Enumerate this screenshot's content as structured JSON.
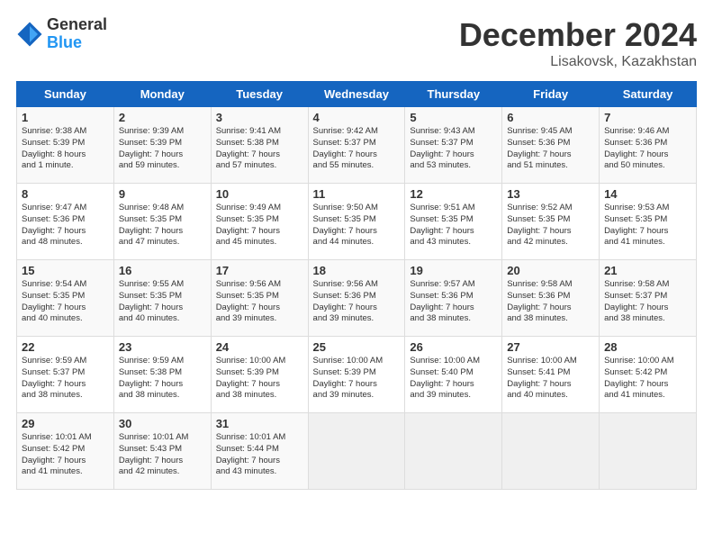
{
  "logo": {
    "general": "General",
    "blue": "Blue"
  },
  "header": {
    "month": "December 2024",
    "location": "Lisakovsk, Kazakhstan"
  },
  "weekdays": [
    "Sunday",
    "Monday",
    "Tuesday",
    "Wednesday",
    "Thursday",
    "Friday",
    "Saturday"
  ],
  "days": [
    {
      "num": "",
      "empty": true,
      "info": ""
    },
    {
      "num": "1",
      "info": "Sunrise: 9:38 AM\nSunset: 5:39 PM\nDaylight: 8 hours\nand 1 minute."
    },
    {
      "num": "2",
      "info": "Sunrise: 9:39 AM\nSunset: 5:39 PM\nDaylight: 7 hours\nand 59 minutes."
    },
    {
      "num": "3",
      "info": "Sunrise: 9:41 AM\nSunset: 5:38 PM\nDaylight: 7 hours\nand 57 minutes."
    },
    {
      "num": "4",
      "info": "Sunrise: 9:42 AM\nSunset: 5:37 PM\nDaylight: 7 hours\nand 55 minutes."
    },
    {
      "num": "5",
      "info": "Sunrise: 9:43 AM\nSunset: 5:37 PM\nDaylight: 7 hours\nand 53 minutes."
    },
    {
      "num": "6",
      "info": "Sunrise: 9:45 AM\nSunset: 5:36 PM\nDaylight: 7 hours\nand 51 minutes."
    },
    {
      "num": "7",
      "info": "Sunrise: 9:46 AM\nSunset: 5:36 PM\nDaylight: 7 hours\nand 50 minutes."
    },
    {
      "num": "8",
      "info": "Sunrise: 9:47 AM\nSunset: 5:36 PM\nDaylight: 7 hours\nand 48 minutes."
    },
    {
      "num": "9",
      "info": "Sunrise: 9:48 AM\nSunset: 5:35 PM\nDaylight: 7 hours\nand 47 minutes."
    },
    {
      "num": "10",
      "info": "Sunrise: 9:49 AM\nSunset: 5:35 PM\nDaylight: 7 hours\nand 45 minutes."
    },
    {
      "num": "11",
      "info": "Sunrise: 9:50 AM\nSunset: 5:35 PM\nDaylight: 7 hours\nand 44 minutes."
    },
    {
      "num": "12",
      "info": "Sunrise: 9:51 AM\nSunset: 5:35 PM\nDaylight: 7 hours\nand 43 minutes."
    },
    {
      "num": "13",
      "info": "Sunrise: 9:52 AM\nSunset: 5:35 PM\nDaylight: 7 hours\nand 42 minutes."
    },
    {
      "num": "14",
      "info": "Sunrise: 9:53 AM\nSunset: 5:35 PM\nDaylight: 7 hours\nand 41 minutes."
    },
    {
      "num": "15",
      "info": "Sunrise: 9:54 AM\nSunset: 5:35 PM\nDaylight: 7 hours\nand 40 minutes."
    },
    {
      "num": "16",
      "info": "Sunrise: 9:55 AM\nSunset: 5:35 PM\nDaylight: 7 hours\nand 40 minutes."
    },
    {
      "num": "17",
      "info": "Sunrise: 9:56 AM\nSunset: 5:35 PM\nDaylight: 7 hours\nand 39 minutes."
    },
    {
      "num": "18",
      "info": "Sunrise: 9:56 AM\nSunset: 5:36 PM\nDaylight: 7 hours\nand 39 minutes."
    },
    {
      "num": "19",
      "info": "Sunrise: 9:57 AM\nSunset: 5:36 PM\nDaylight: 7 hours\nand 38 minutes."
    },
    {
      "num": "20",
      "info": "Sunrise: 9:58 AM\nSunset: 5:36 PM\nDaylight: 7 hours\nand 38 minutes."
    },
    {
      "num": "21",
      "info": "Sunrise: 9:58 AM\nSunset: 5:37 PM\nDaylight: 7 hours\nand 38 minutes."
    },
    {
      "num": "22",
      "info": "Sunrise: 9:59 AM\nSunset: 5:37 PM\nDaylight: 7 hours\nand 38 minutes."
    },
    {
      "num": "23",
      "info": "Sunrise: 9:59 AM\nSunset: 5:38 PM\nDaylight: 7 hours\nand 38 minutes."
    },
    {
      "num": "24",
      "info": "Sunrise: 10:00 AM\nSunset: 5:39 PM\nDaylight: 7 hours\nand 38 minutes."
    },
    {
      "num": "25",
      "info": "Sunrise: 10:00 AM\nSunset: 5:39 PM\nDaylight: 7 hours\nand 39 minutes."
    },
    {
      "num": "26",
      "info": "Sunrise: 10:00 AM\nSunset: 5:40 PM\nDaylight: 7 hours\nand 39 minutes."
    },
    {
      "num": "27",
      "info": "Sunrise: 10:00 AM\nSunset: 5:41 PM\nDaylight: 7 hours\nand 40 minutes."
    },
    {
      "num": "28",
      "info": "Sunrise: 10:00 AM\nSunset: 5:42 PM\nDaylight: 7 hours\nand 41 minutes."
    },
    {
      "num": "29",
      "info": "Sunrise: 10:01 AM\nSunset: 5:42 PM\nDaylight: 7 hours\nand 41 minutes."
    },
    {
      "num": "30",
      "info": "Sunrise: 10:01 AM\nSunset: 5:43 PM\nDaylight: 7 hours\nand 42 minutes."
    },
    {
      "num": "31",
      "info": "Sunrise: 10:01 AM\nSunset: 5:44 PM\nDaylight: 7 hours\nand 43 minutes."
    },
    {
      "num": "",
      "empty": true,
      "info": ""
    },
    {
      "num": "",
      "empty": true,
      "info": ""
    },
    {
      "num": "",
      "empty": true,
      "info": ""
    },
    {
      "num": "",
      "empty": true,
      "info": ""
    }
  ]
}
